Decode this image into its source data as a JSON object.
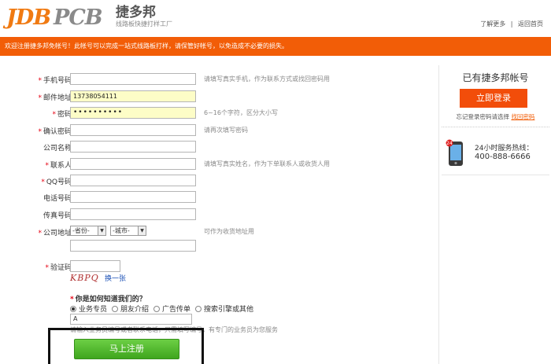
{
  "header": {
    "logo_left": "JDB",
    "logo_right": "PCB",
    "brand_cn": "捷多邦",
    "brand_sub": "线路板快捷打样工厂",
    "links": [
      "了解更多",
      "返回首页"
    ],
    "separator": "|"
  },
  "notice": "欢迎注册捷多邦免帐号！此帐号可以完成一站式线路板打样，请保管好帐号，以免造成不必要的损失。",
  "form": {
    "phone": {
      "label": "手机号码",
      "value": "",
      "hint": "请填写真实手机，作为联系方式或找回密码用"
    },
    "email": {
      "label": "邮件地址",
      "value": "13738054111"
    },
    "password": {
      "label": "密码",
      "value": "••••••••••",
      "hint": "6~16个字符，区分大小写"
    },
    "confirm": {
      "label": "确认密码",
      "value": "",
      "hint": "请再次填写密码"
    },
    "company": {
      "label": "公司名称",
      "value": ""
    },
    "contact": {
      "label": "联系人",
      "value": "",
      "hint": "请填写真实姓名，作为下单联系人或收货人用"
    },
    "qq": {
      "label": "QQ号码",
      "value": ""
    },
    "tel": {
      "label": "电话号码",
      "value": ""
    },
    "fax": {
      "label": "传真号码",
      "value": ""
    },
    "address": {
      "label": "公司地址",
      "province": "-省份-",
      "city": "-城市-",
      "value": "",
      "hint": "可作为收货地址用"
    },
    "verify": {
      "label": "验证码",
      "value": "",
      "captcha": "KBPQ",
      "refresh": "换一张"
    },
    "source": {
      "question": "你是如何知道我们的？",
      "options": [
        "业务专员",
        "朋友介绍",
        "广告传单",
        "搜索引擎或其他"
      ],
      "selected": 0,
      "input_value": "A",
      "hint": "请输入业务员编号或者联系电话，只需填写编号，有专门的业务员为您服务"
    },
    "required_mark": "*",
    "submit": "马上注册"
  },
  "sidebar": {
    "title": "已有捷多邦帐号",
    "login": "立即登录",
    "forgot_text": "忘记登录密码请选择",
    "forgot_link": "找回密码",
    "hotline_label": "24小时服务热线：",
    "hotline_number": "400-888-6666"
  },
  "colors": {
    "accent": "#f25d07",
    "submit": "#4cb82a",
    "required": "#e60012"
  }
}
